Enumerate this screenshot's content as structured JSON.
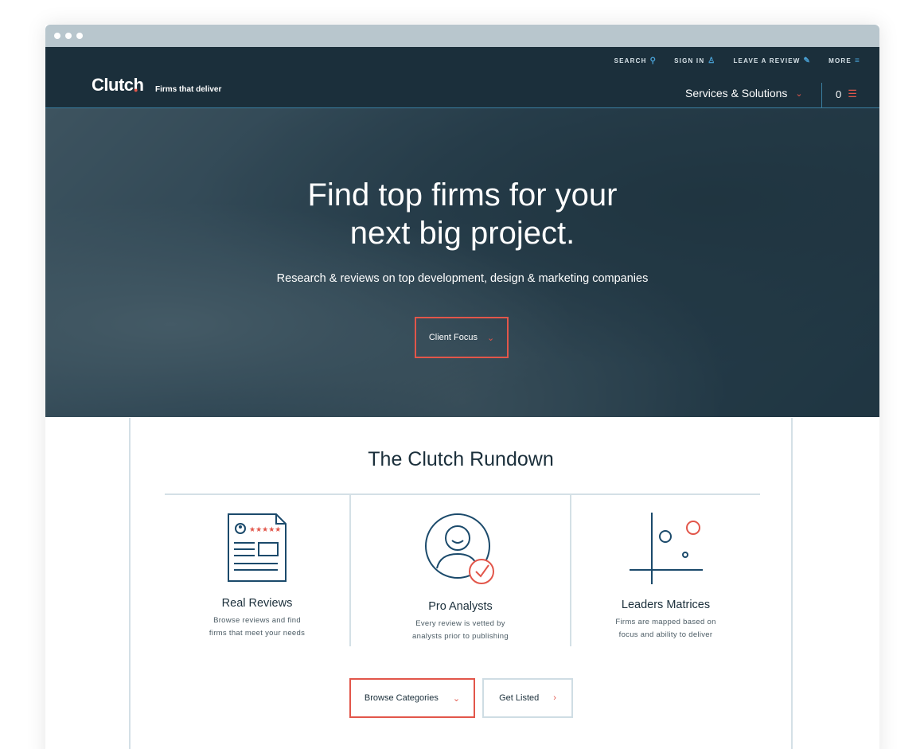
{
  "nav": {
    "brand": "Clutch",
    "tagline": "Firms that deliver",
    "utility": [
      {
        "label": "SEARCH",
        "icon": "search-icon"
      },
      {
        "label": "SIGN IN",
        "icon": "user-icon"
      },
      {
        "label": "LEAVE A REVIEW",
        "icon": "pencil-icon"
      },
      {
        "label": "MORE",
        "icon": "menu-icon"
      }
    ],
    "services_label": "Services & Solutions",
    "cart_count": "0"
  },
  "hero": {
    "title_line1": "Find top firms for your",
    "title_line2": "next big project.",
    "subtitle": "Research & reviews on top development, design & marketing companies",
    "client_focus_label": "Client Focus"
  },
  "rundown": {
    "title": "The Clutch Rundown",
    "columns": [
      {
        "title": "Real Reviews",
        "line1": "Browse reviews and find",
        "line2": "firms that meet your needs",
        "icon": "review-document-icon"
      },
      {
        "title": "Pro Analysts",
        "line1": "Every review is vetted by",
        "line2": "analysts prior to publishing",
        "icon": "analyst-check-icon"
      },
      {
        "title": "Leaders Matrices",
        "line1": "Firms are mapped based on",
        "line2": "focus and ability to deliver",
        "icon": "matrix-chart-icon"
      }
    ],
    "browse_label": "Browse Categories",
    "listed_label": "Get Listed"
  },
  "colors": {
    "navy": "#1b2f3b",
    "accent_red": "#e2564a",
    "accent_blue": "#4aa3d8",
    "border": "#d4e0e6"
  }
}
